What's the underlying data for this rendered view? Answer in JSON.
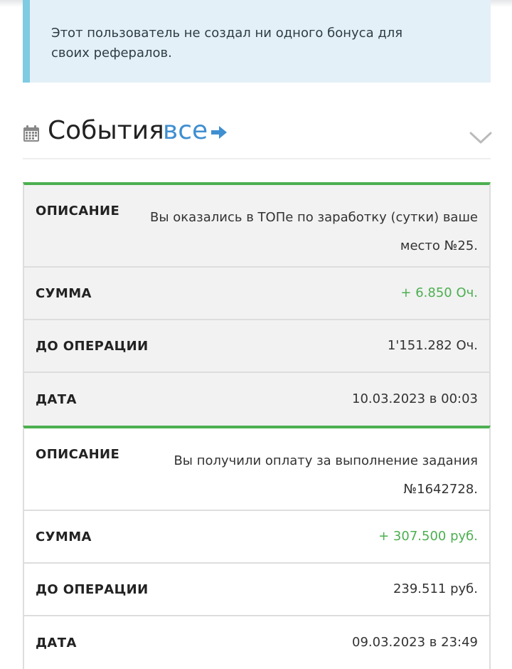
{
  "referral_notice": {
    "text": "Этот пользователь не создал ни одного бонуса для своих рефералов."
  },
  "events_section": {
    "title": "События",
    "all_link": "все",
    "icons": {
      "calendar": "calendar-icon",
      "arrow": "arrow-right-icon",
      "collapse": "chevron-down-icon"
    }
  },
  "colors": {
    "accent_green": "#4caf50",
    "link_blue": "#3f8fd1",
    "info_border": "#7fcbe2",
    "info_background": "#e4f0f7"
  },
  "events": [
    {
      "description_label": "ОПИСАНИЕ",
      "description": "Вы оказались в ТОПе по заработку (сутки) ваше место №25.",
      "amount_label": "СУММА",
      "amount": "+ 6.850 Оч.",
      "before_label": "ДО ОПЕРАЦИИ",
      "before": "1'151.282 Оч.",
      "date_label": "ДАТА",
      "date": "10.03.2023 в 00:03"
    },
    {
      "description_label": "ОПИСАНИЕ",
      "description": "Вы получили оплату за выполнение задания №1642728.",
      "amount_label": "СУММА",
      "amount": "+ 307.500 руб.",
      "before_label": "ДО ОПЕРАЦИИ",
      "before": "239.511 руб.",
      "date_label": "ДАТА",
      "date": "09.03.2023 в 23:49"
    }
  ]
}
